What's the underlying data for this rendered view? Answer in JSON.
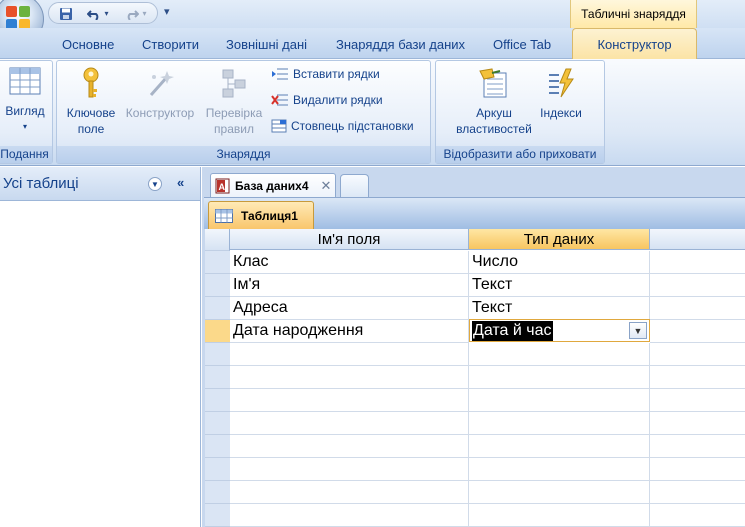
{
  "contextual_tab_group": "Табличні знаряддя",
  "tabs": [
    "Основне",
    "Створити",
    "Зовнішні дані",
    "Знаряддя бази даних",
    "Office Tab"
  ],
  "active_tab": "Конструктор",
  "ribbon": {
    "groups": {
      "views": "Подання",
      "tools": "Знаряддя",
      "show_hide": "Відобразити або приховати"
    },
    "view_button": "Вигляд",
    "primary_key_line1": "Ключове",
    "primary_key_line2": "поле",
    "builder": "Конструктор",
    "test_line1": "Перевірка",
    "test_line2": "правил",
    "insert_rows": "Вставити рядки",
    "delete_rows": "Видалити рядки",
    "lookup_column": "Стовпець підстановки",
    "property_sheet_line1": "Аркуш",
    "property_sheet_line2": "властивостей",
    "indexes": "Індекси"
  },
  "nav_pane": {
    "title": "Усі таблиці"
  },
  "document_tab": "База даних4",
  "object_tab": "Таблиця1",
  "grid": {
    "headers": [
      "Ім'я поля",
      "Тип даних"
    ],
    "rows": [
      {
        "field": "Клас",
        "type": "Число"
      },
      {
        "field": "Ім'я",
        "type": "Текст"
      },
      {
        "field": "Адреса",
        "type": "Текст"
      },
      {
        "field": "Дата народження",
        "type": "Дата й час"
      }
    ],
    "current_row": 3
  },
  "colors": {
    "ribbon_text": "#15428b",
    "selected_header": "#f7c560",
    "current_row_selector": "#fbd98a"
  }
}
